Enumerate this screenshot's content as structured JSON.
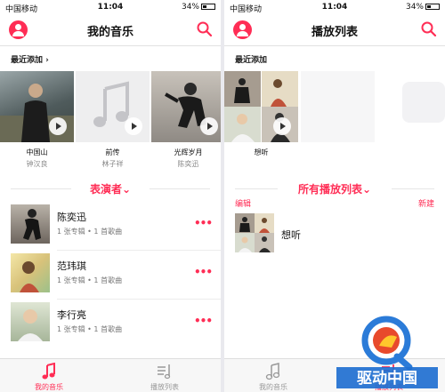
{
  "left": {
    "status": {
      "carrier": "中国移动",
      "time": "11:04",
      "battery": "34%"
    },
    "nav_title": "我的音乐",
    "recent_header": "最近添加",
    "albums": [
      {
        "title": "中国山",
        "artist": "钟汉良"
      },
      {
        "title": "前传",
        "artist": "林子祥"
      },
      {
        "title": "光辉岁月",
        "artist": "陈奕迅"
      }
    ],
    "section_title": "表演者",
    "artists": [
      {
        "name": "陈奕迅",
        "meta": "1 张专辑 • 1 首歌曲"
      },
      {
        "name": "范玮琪",
        "meta": "1 张专辑 • 1 首歌曲"
      },
      {
        "name": "李行亮",
        "meta": "1 张专辑 • 1 首歌曲"
      }
    ],
    "more_label": "•••",
    "tabs": [
      {
        "label": "我的音乐",
        "icon": "music-note-icon"
      },
      {
        "label": "播放列表",
        "icon": "playlist-icon"
      }
    ]
  },
  "right": {
    "status": {
      "carrier": "中国移动",
      "time": "11:04",
      "battery": "34%"
    },
    "nav_title": "播放列表",
    "recent_header": "最近添加",
    "recent_playlist": {
      "title": "想听"
    },
    "section_title": "所有播放列表",
    "edit_label": "编辑",
    "new_label": "新建",
    "playlist": {
      "title": "想听"
    },
    "tabs": [
      {
        "label": "我的音乐",
        "icon": "music-note-icon"
      },
      {
        "label": "播放列表",
        "icon": "playlist-icon"
      }
    ]
  },
  "watermark": {
    "text": "驱动中国"
  },
  "colors": {
    "accent": "#ff2d55",
    "background": "#ffffff"
  }
}
